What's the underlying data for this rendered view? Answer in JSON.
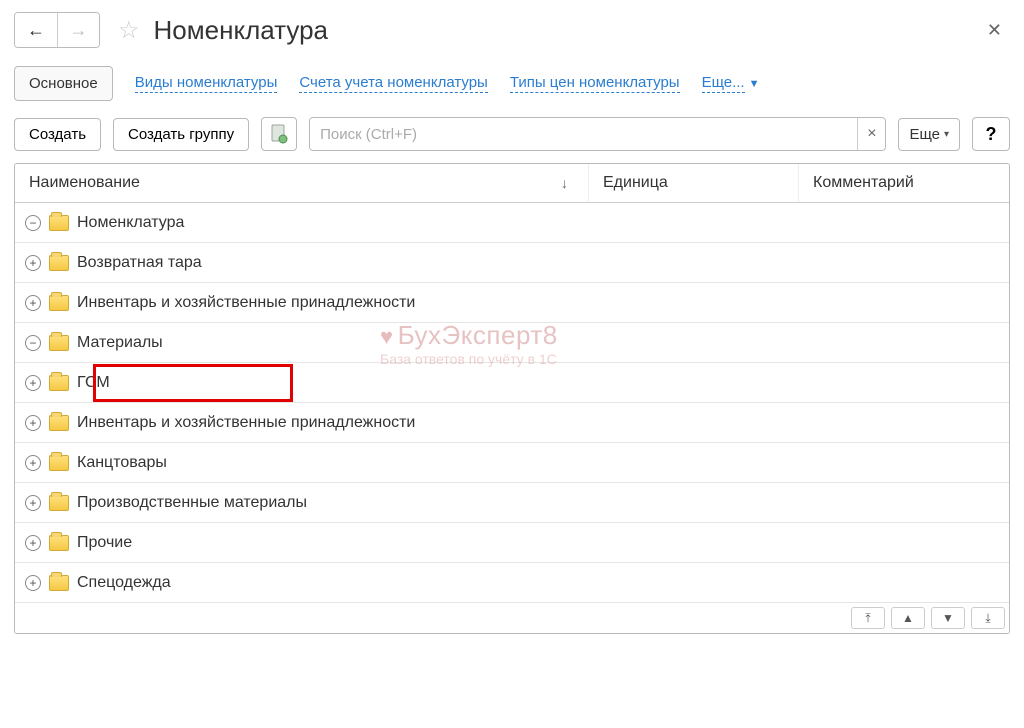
{
  "header": {
    "title": "Номенклатура"
  },
  "tabs": {
    "main": "Основное",
    "links": [
      "Виды номенклатуры",
      "Счета учета номенклатуры",
      "Типы цен номенклатуры"
    ],
    "more": "Еще..."
  },
  "toolbar": {
    "create": "Создать",
    "create_group": "Создать группу",
    "search_placeholder": "Поиск (Ctrl+F)",
    "more": "Еще",
    "help": "?"
  },
  "columns": {
    "name": "Наименование",
    "unit": "Единица",
    "comment": "Комментарий"
  },
  "tree": [
    {
      "indent": 0,
      "expander": "⊖",
      "label": "Номенклатура"
    },
    {
      "indent": 1,
      "expander": "⊕",
      "label": "Возвратная тара"
    },
    {
      "indent": 1,
      "expander": "⊕",
      "label": "Инвентарь и хозяйственные принадлежности"
    },
    {
      "indent": 1,
      "expander": "⊖",
      "label": "Материалы"
    },
    {
      "indent": 2,
      "expander": "⊕",
      "label": "ГСМ",
      "highlight": true
    },
    {
      "indent": 2,
      "expander": "⊕",
      "label": "Инвентарь и хозяйственные принадлежности"
    },
    {
      "indent": 2,
      "expander": "⊕",
      "label": "Канцтовары"
    },
    {
      "indent": 2,
      "expander": "⊕",
      "label": "Производственные материалы"
    },
    {
      "indent": 2,
      "expander": "⊕",
      "label": "Прочие"
    },
    {
      "indent": 2,
      "expander": "⊕",
      "label": "Спецодежда"
    }
  ],
  "watermark": {
    "title": "БухЭксперт8",
    "subtitle": "База ответов по учёту в 1С"
  }
}
